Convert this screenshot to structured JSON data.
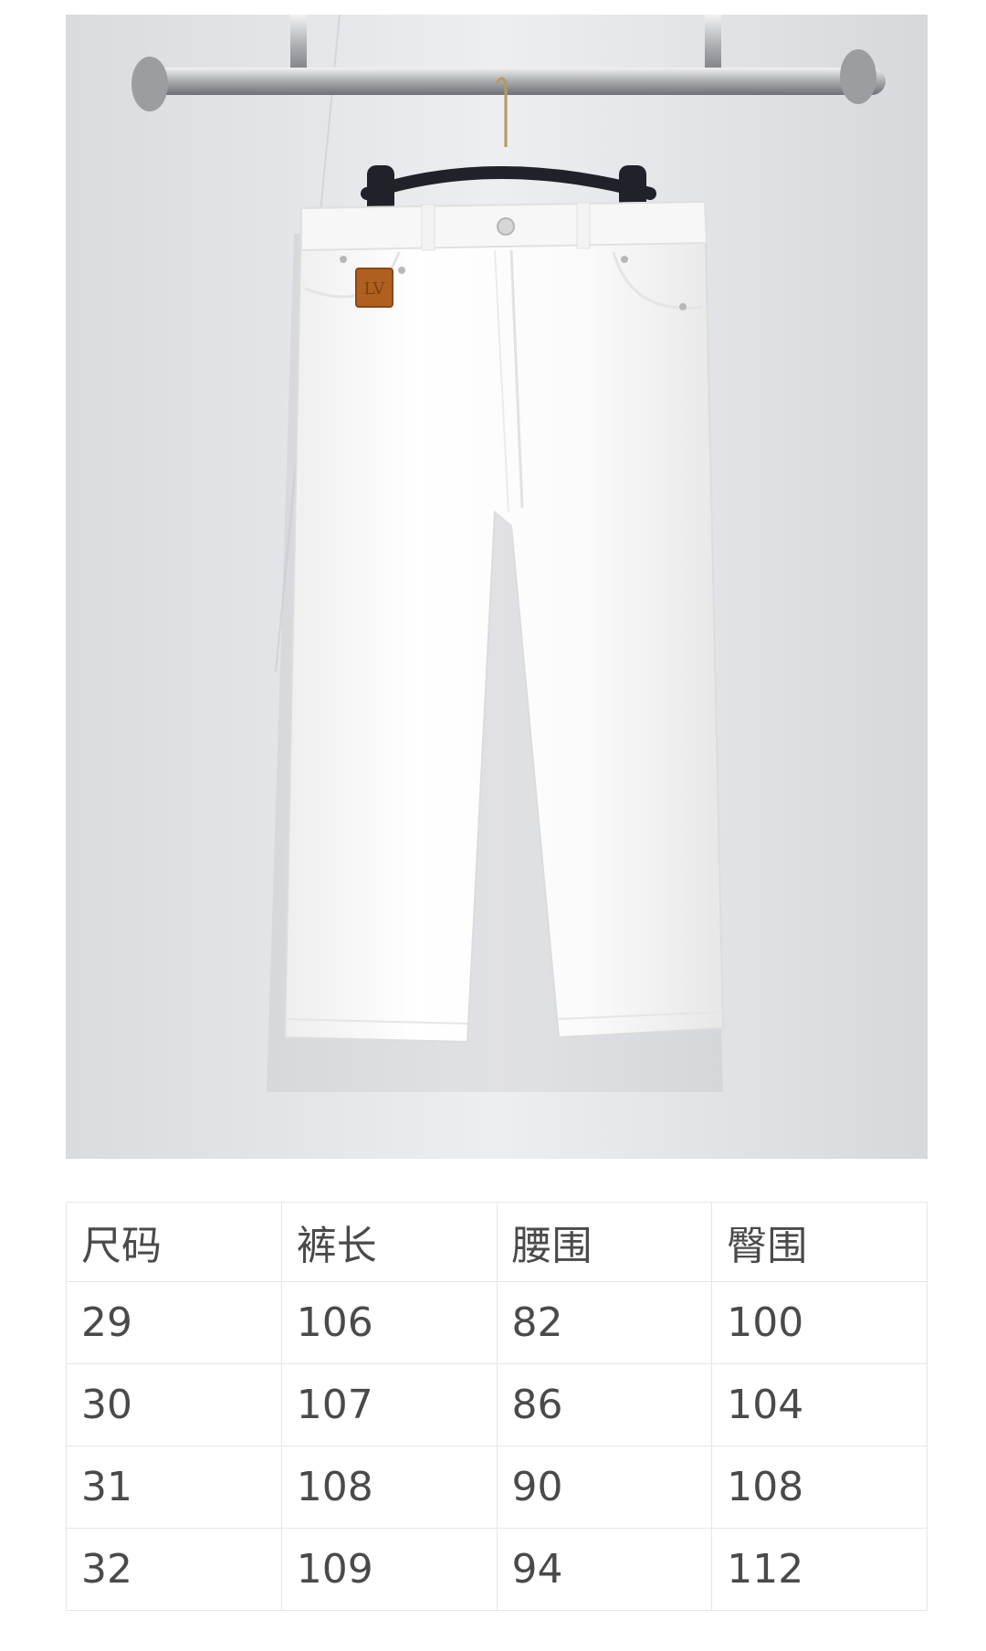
{
  "photo": {
    "subject": "white wide-leg trousers on a black hanger on a wall-mounted rail",
    "colors": {
      "wall": "#eceef1",
      "garment": "#ffffff",
      "hanger": "#1f2228",
      "rail": "#c2c3c7",
      "patch": "#b0601e"
    },
    "patch_logo": "LV"
  },
  "table": {
    "headers": [
      "尺码",
      "裤长",
      "腰围",
      "臀围"
    ],
    "rows": [
      [
        "29",
        "106",
        "82",
        "100"
      ],
      [
        "30",
        "107",
        "86",
        "104"
      ],
      [
        "31",
        "108",
        "90",
        "108"
      ],
      [
        "32",
        "109",
        "94",
        "112"
      ]
    ]
  }
}
